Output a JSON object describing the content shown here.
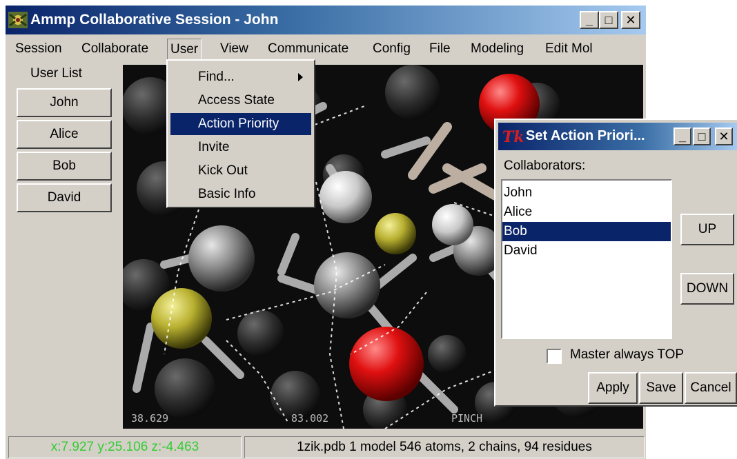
{
  "window": {
    "title": "Ammp Collaborative Session - John",
    "minimize": "_",
    "maximize": "□",
    "close": "✕"
  },
  "menubar": [
    {
      "label": "Session"
    },
    {
      "label": "Collaborate"
    },
    {
      "label": "User"
    },
    {
      "label": "View"
    },
    {
      "label": "Communicate"
    },
    {
      "label": "Config"
    },
    {
      "label": "File"
    },
    {
      "label": "Modeling"
    },
    {
      "label": "Edit Mol"
    }
  ],
  "user_menu": {
    "items": [
      "Find...",
      "Access State",
      "Action Priority",
      "Invite",
      "Kick Out",
      "Basic Info"
    ],
    "selected": "Action Priority"
  },
  "user_list": {
    "label": "User List",
    "users": [
      "John",
      "Alice",
      "Bob",
      "David"
    ]
  },
  "viewport": {
    "coord_left": "38.629",
    "coord_mid": "83.002",
    "coord_right": "PINCH"
  },
  "status": {
    "coords": "x:7.927 y:25.106 z:-4.463",
    "coords_color": "#33cc33",
    "info": "1zik.pdb 1 model  546 atoms, 2 chains, 94 residues"
  },
  "dialog": {
    "title": "Set Action Priori...",
    "minimize": "_",
    "maximize": "□",
    "close": "✕",
    "collaborators_label": "Collaborators:",
    "collaborators": [
      "John",
      "Alice",
      "Bob",
      "David"
    ],
    "selected": "Bob",
    "up": "UP",
    "down": "DOWN",
    "master_label": "Master always TOP",
    "master_checked": false,
    "apply": "Apply",
    "save": "Save",
    "cancel": "Cancel"
  },
  "colors": {
    "selection": "#0a246a",
    "chrome": "#d4d0c8",
    "atom_red": "#e01010",
    "atom_yellow": "#b8b030",
    "atom_grey": "#8c8c8c"
  }
}
